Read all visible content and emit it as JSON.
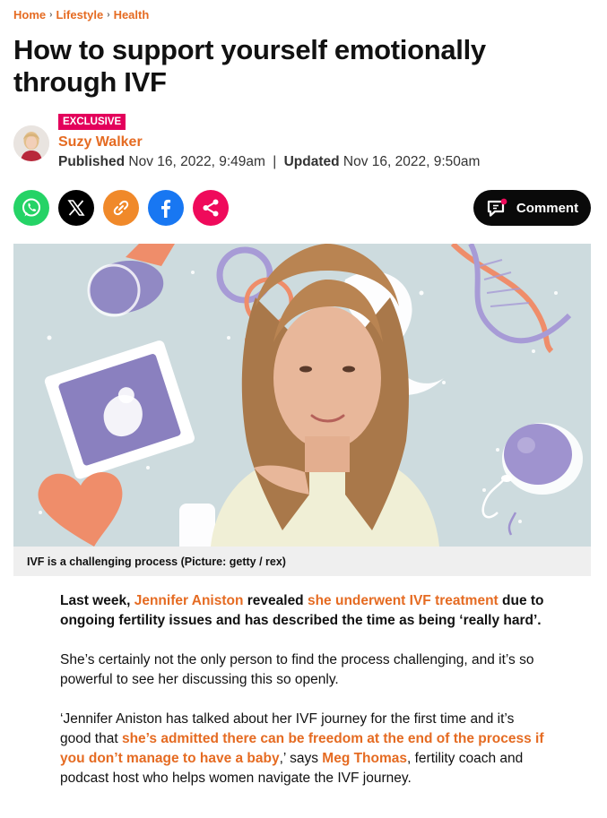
{
  "breadcrumb": {
    "items": [
      "Home",
      "Lifestyle",
      "Health"
    ],
    "separator": "›"
  },
  "headline": "How to support yourself emotionally through IVF",
  "byline": {
    "badge": "EXCLUSIVE",
    "author": "Suzy Walker",
    "published_label": "Published",
    "published_date": "Nov 16, 2022, 9:49am",
    "divider": "|",
    "updated_label": "Updated",
    "updated_date": "Nov 16, 2022, 9:50am"
  },
  "share": {
    "buttons": [
      "whatsapp-icon",
      "x-icon",
      "link-icon",
      "facebook-icon",
      "share-icon"
    ],
    "colors": {
      "whatsapp": "#25d366",
      "x": "#000000",
      "link": "#f0892a",
      "facebook": "#1877f2",
      "share": "#ef0a5b"
    },
    "comment_label": "Comment"
  },
  "hero": {
    "caption": "IVF is a challenging process (Picture: getty / rex)"
  },
  "article": {
    "p1": {
      "t1": "Last week, ",
      "link1": "Jennifer Aniston",
      "t2": " revealed ",
      "link2": "she underwent IVF treatment",
      "t3": " due to ongoing fertility issues and has described the time as being ‘really hard’."
    },
    "p2": "She’s certainly not the only person to find the process challenging, and it’s so powerful to see her discussing this so openly.",
    "p3": {
      "t1": "‘Jennifer Aniston has talked about her IVF journey for the first time and it’s good that ",
      "link1": "she’s admitted there can be freedom at the end of the process if you don’t manage to have a baby",
      "t2": ",’ says ",
      "link2": "Meg Thomas",
      "t3": ", fertility coach and podcast host who helps women navigate the IVF journey."
    }
  },
  "accent_color": "#e56b22"
}
